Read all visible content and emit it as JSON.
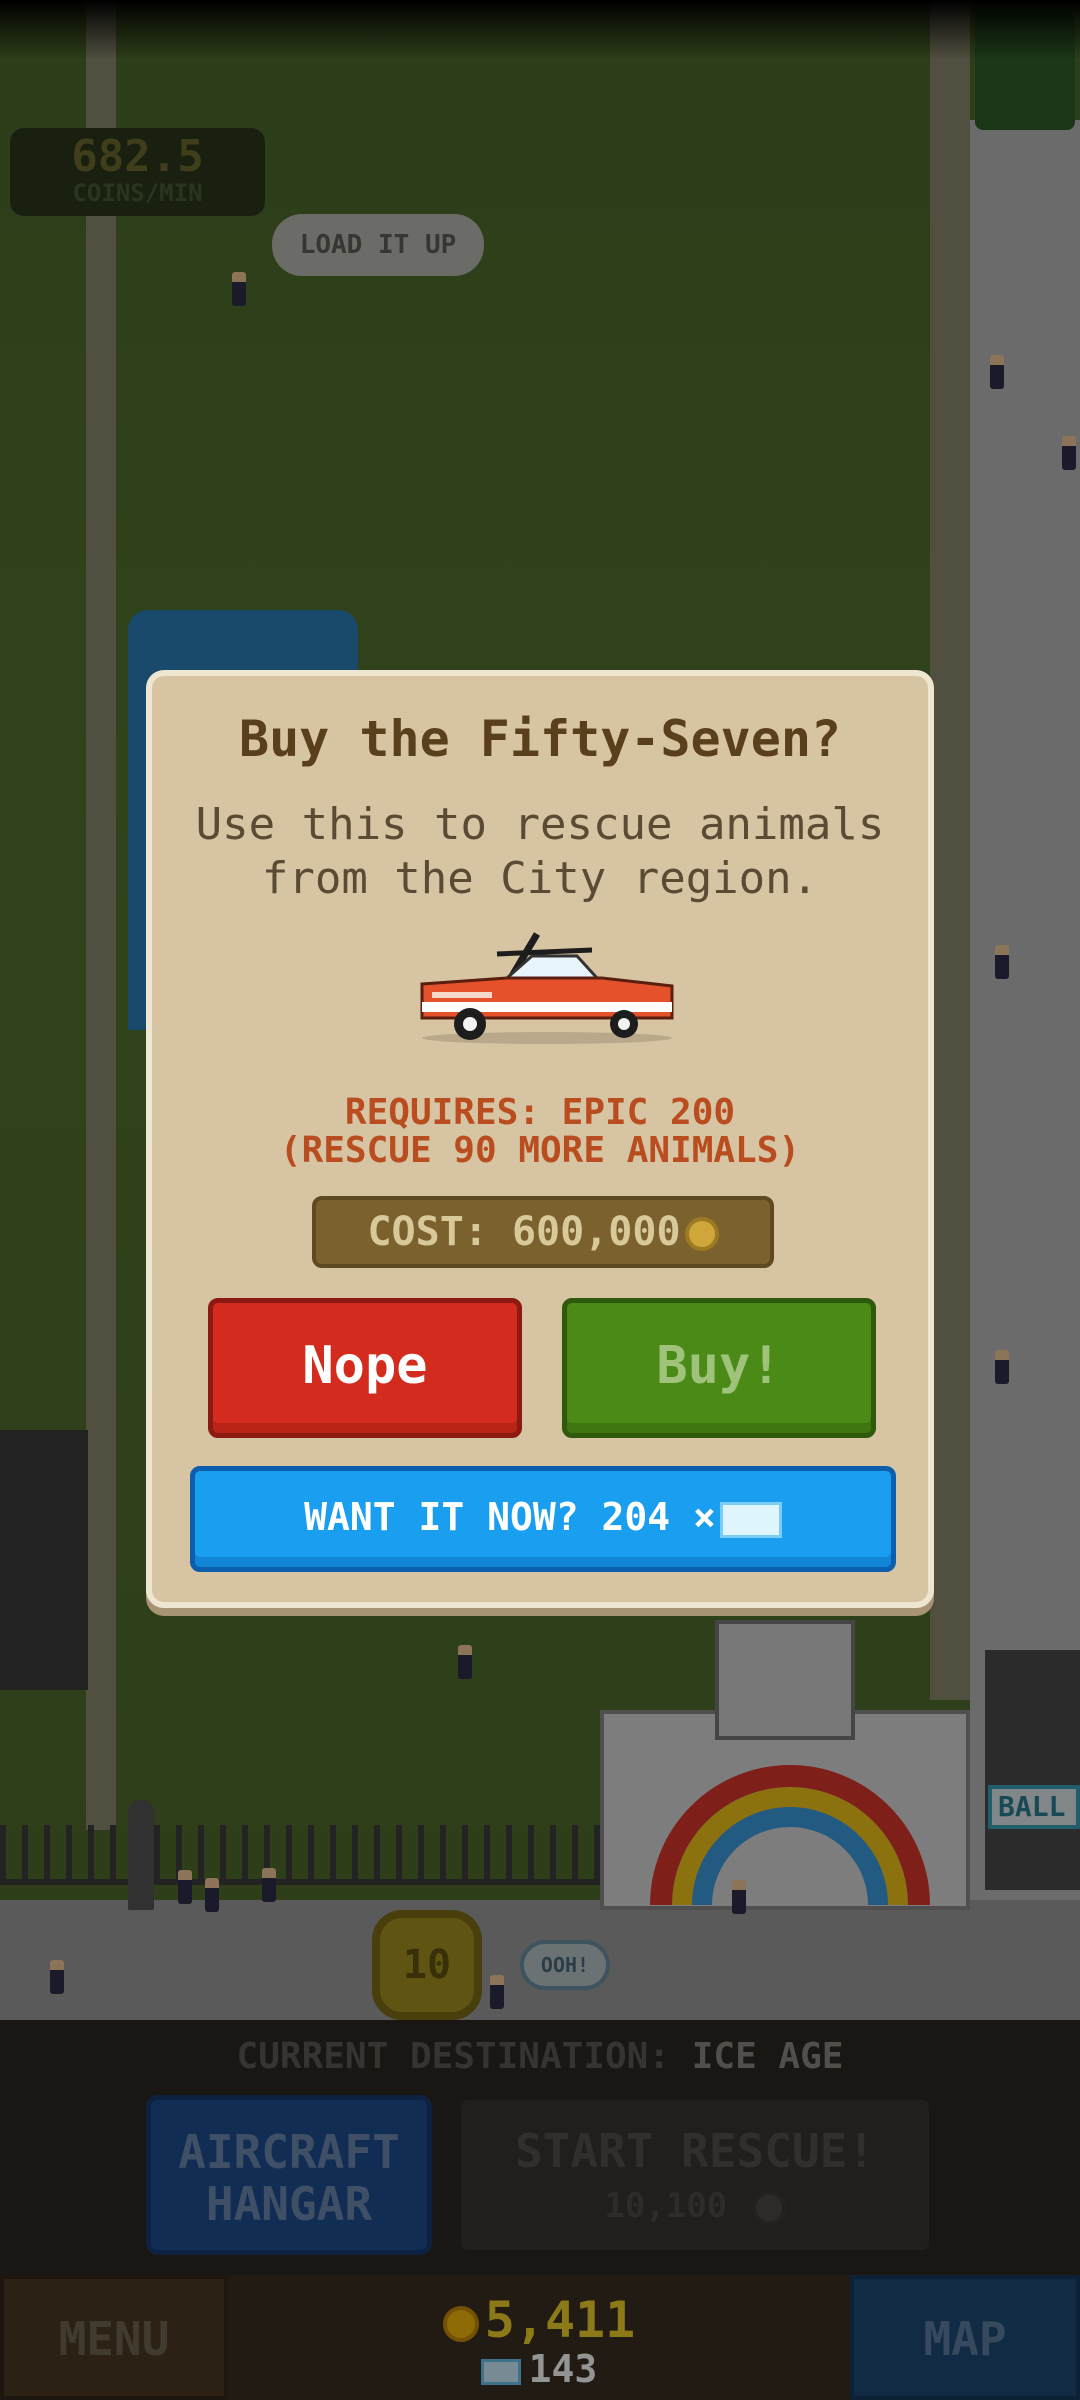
{
  "hud": {
    "rate_value": "682.5",
    "rate_label": "COINS/MIN",
    "load_bubble": "LOAD IT UP",
    "coin_token": "10",
    "ooh_bubble": "OOH!",
    "ball_sign": "BALL"
  },
  "modal": {
    "title": "Buy the Fifty-Seven?",
    "description_line1": "Use this to rescue animals",
    "description_line2": "from the City region.",
    "requires_line1": "REQUIRES: EPIC 200",
    "requires_line2": "(RESCUE 90 MORE ANIMALS)",
    "cost_text": "COST: 600,000",
    "nope_label": "Nope",
    "buy_label": "Buy!",
    "want_now_label": "WANT IT NOW? 204 ×"
  },
  "bottom": {
    "destination_label": "CURRENT DESTINATION:",
    "destination_value": "ICE AGE",
    "hangar_line1": "AIRCRAFT",
    "hangar_line2": "HANGAR",
    "start_rescue_label": "START RESCUE!",
    "start_rescue_cost": "10,100",
    "menu_label": "MENU",
    "map_label": "MAP",
    "coins": "5,411",
    "gems": "143"
  },
  "colors": {
    "modal_bg": "#d6c4a2",
    "nope_red": "#d42b1f",
    "buy_green": "#4b8a16",
    "want_blue": "#1a9ef0",
    "requires_orange": "#b94d1f",
    "coin_yellow": "#f2d22a"
  }
}
